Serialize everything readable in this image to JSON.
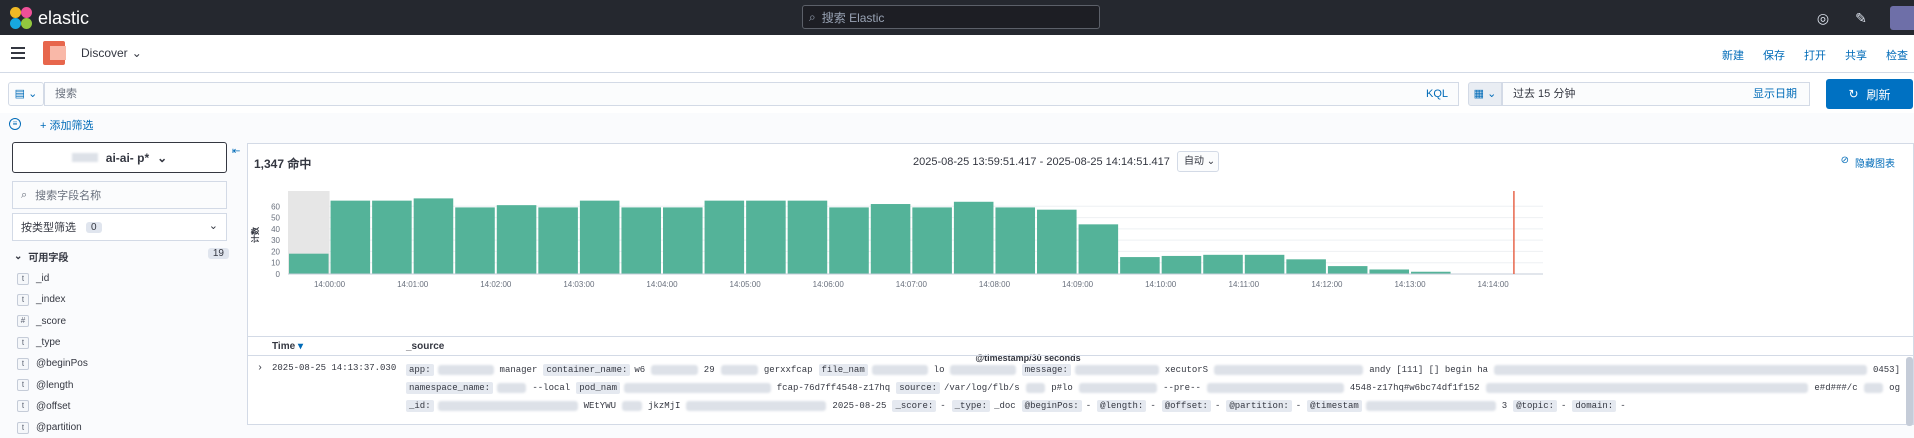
{
  "app": {
    "logo_text": "elastic",
    "search_placeholder": "搜索 Elastic"
  },
  "nav": {
    "breadcrumb": "Discover",
    "actions": [
      "新建",
      "保存",
      "打开",
      "共享",
      "检查"
    ]
  },
  "query": {
    "placeholder": "搜索",
    "language": "KQL",
    "date_range": "过去 15 分钟",
    "show_dates": "显示日期",
    "refresh": "刷新"
  },
  "filter": {
    "add_filter": "+ 添加筛选"
  },
  "sidebar": {
    "index_pattern": "ai-ai-     p*",
    "field_search_placeholder": "搜索字段名称",
    "type_filter_label": "按类型筛选",
    "type_filter_count": "0",
    "available_fields_label": "可用字段",
    "available_fields_count": "19",
    "fields": [
      {
        "type": "t",
        "name": "_id"
      },
      {
        "type": "t",
        "name": "_index"
      },
      {
        "type": "#",
        "name": "_score"
      },
      {
        "type": "t",
        "name": "_type"
      },
      {
        "type": "t",
        "name": "@beginPos"
      },
      {
        "type": "t",
        "name": "@length"
      },
      {
        "type": "t",
        "name": "@offset"
      },
      {
        "type": "t",
        "name": "@partition"
      }
    ]
  },
  "main": {
    "hits": "1,347 命中",
    "time_range": "2025-08-25 13:59:51.417 - 2025-08-25 14:14:51.417",
    "interval": "自动",
    "hide_chart": "隐藏图表",
    "table": {
      "col_time": "Time",
      "col_source": "_source",
      "rows": [
        {
          "time": "2025-08-25 14:13:37.030"
        }
      ]
    }
  },
  "chart_data": {
    "type": "bar",
    "title": "",
    "xlabel": "@timestamp/30 seconds",
    "ylabel": "计数",
    "ylim": [
      0,
      70
    ],
    "yticks": [
      0,
      10,
      20,
      30,
      40,
      50,
      60
    ],
    "xtick_labels": [
      "14:00:00",
      "14:01:00",
      "14:02:00",
      "14:03:00",
      "14:04:00",
      "14:05:00",
      "14:06:00",
      "14:07:00",
      "14:08:00",
      "14:09:00",
      "14:10:00",
      "14:11:00",
      "14:12:00",
      "14:13:00",
      "14:14:00"
    ],
    "values": [
      18,
      65,
      65,
      67,
      59,
      61,
      59,
      65,
      59,
      59,
      65,
      65,
      65,
      59,
      62,
      59,
      64,
      59,
      57,
      44,
      15,
      16,
      17,
      17,
      13,
      7,
      4,
      2
    ],
    "bar_color": "#54b399",
    "partial_bucket_fill": "#e6e6e6",
    "now_marker_color": "#e7664c"
  }
}
